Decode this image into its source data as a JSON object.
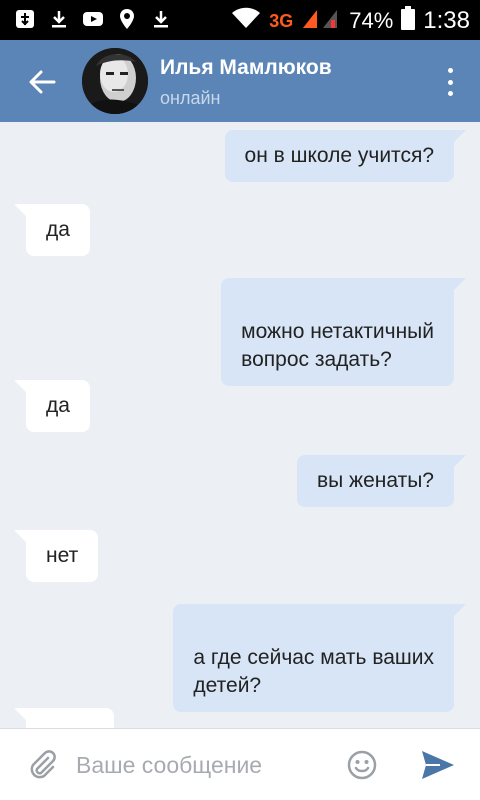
{
  "status_bar": {
    "network": "3G",
    "battery": "74%",
    "time": "1:38"
  },
  "header": {
    "contact_name": "Илья Мамлюков",
    "contact_status": "онлайн"
  },
  "messages": [
    {
      "direction": "out",
      "text": "он в школе учится?"
    },
    {
      "direction": "in",
      "text": "да"
    },
    {
      "direction": "out",
      "text": "можно нетактичный\nвопрос задать?"
    },
    {
      "direction": "in",
      "text": "да"
    },
    {
      "direction": "out",
      "text": "вы женаты?"
    },
    {
      "direction": "in",
      "text": "нет"
    },
    {
      "direction": "out",
      "text": "а где сейчас мать ваших\nдетей?"
    },
    {
      "direction": "in",
      "text": ""
    }
  ],
  "composer": {
    "placeholder": "Ваше сообщение",
    "value": ""
  },
  "colors": {
    "header": "#5b85b6",
    "outgoing_bubble": "#d7e5f6",
    "incoming_bubble": "#ffffff",
    "chat_background": "#eceff3",
    "send_icon": "#4a76a8"
  },
  "icons": [
    "usb-icon",
    "download-icon",
    "youtube-icon",
    "location-icon",
    "download-icon",
    "wifi-icon",
    "signal-icon",
    "battery-icon",
    "back-arrow-icon",
    "more-vert-icon",
    "paperclip-icon",
    "emoji-icon",
    "send-icon"
  ]
}
